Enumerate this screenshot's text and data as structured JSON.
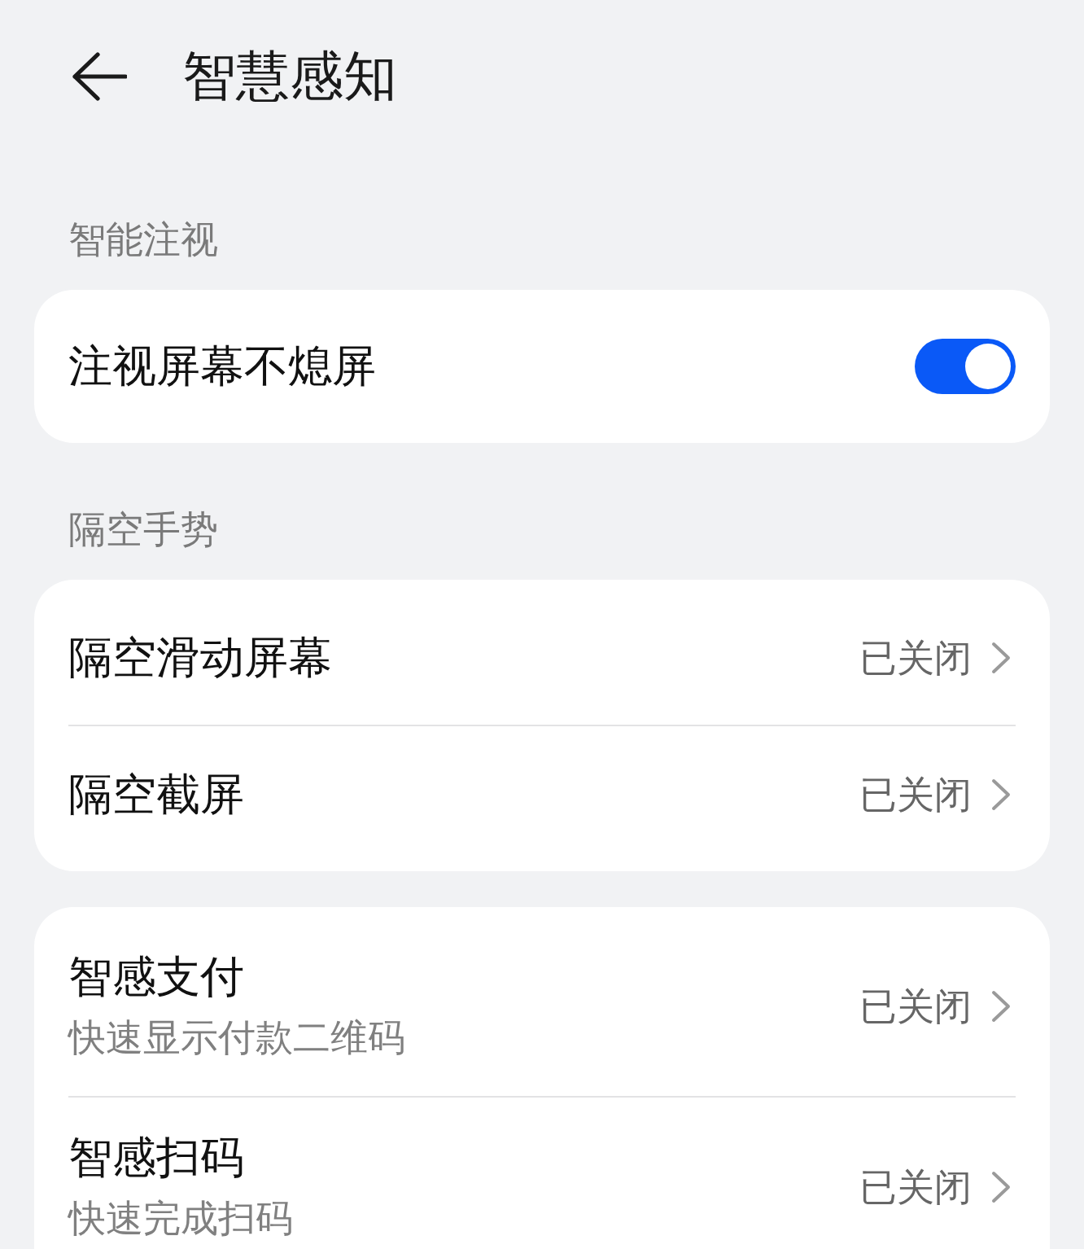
{
  "header": {
    "title": "智慧感知"
  },
  "sections": [
    {
      "heading": "智能注视",
      "items": [
        {
          "kind": "toggle",
          "title": "注视屏幕不熄屏",
          "on": true
        }
      ]
    },
    {
      "heading": "隔空手势",
      "items": [
        {
          "kind": "link",
          "title": "隔空滑动屏幕",
          "value": "已关闭"
        },
        {
          "kind": "link",
          "title": "隔空截屏",
          "value": "已关闭"
        }
      ]
    },
    {
      "items": [
        {
          "kind": "link",
          "title": "智感支付",
          "subtitle": "快速显示付款二维码",
          "value": "已关闭"
        },
        {
          "kind": "link",
          "title": "智感扫码",
          "subtitle": "快速完成扫码",
          "value": "已关闭"
        }
      ]
    }
  ]
}
